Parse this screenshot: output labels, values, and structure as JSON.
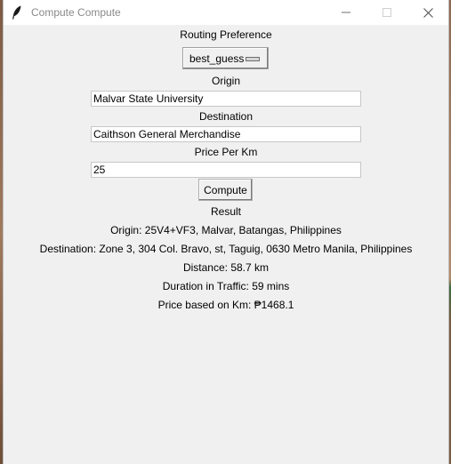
{
  "window": {
    "title": "Compute Compute"
  },
  "routing": {
    "label": "Routing Preference",
    "selected": "best_guess"
  },
  "origin": {
    "label": "Origin",
    "value": "Malvar State University"
  },
  "destination": {
    "label": "Destination",
    "value": "Caithson General Merchandise"
  },
  "price": {
    "label": "Price Per Km",
    "value": "25"
  },
  "compute": {
    "label": "Compute"
  },
  "result": {
    "label": "Result",
    "origin": "Origin: 25V4+VF3, Malvar, Batangas, Philippines",
    "destination": "Destination: Zone 3, 304 Col. Bravo, st, Taguig, 0630 Metro Manila, Philippines",
    "distance": "Distance: 58.7 km",
    "duration": "Duration in Traffic: 59 mins",
    "price": "Price based on Km: ₱1468.1"
  },
  "icons": {
    "app": "feather-icon",
    "minimize": "minimize-icon",
    "maximize": "maximize-icon",
    "close": "close-icon"
  }
}
